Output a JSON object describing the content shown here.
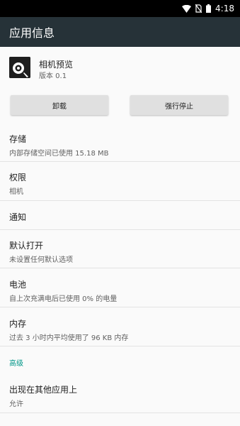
{
  "status_bar": {
    "time": "4:18"
  },
  "app_bar": {
    "title": "应用信息"
  },
  "app": {
    "name": "相机预览",
    "version": "版本 0.1"
  },
  "buttons": {
    "uninstall": "卸载",
    "force_stop": "强行停止"
  },
  "settings": {
    "storage": {
      "title": "存储",
      "summary": "内部存储空间已使用 15.18 MB"
    },
    "permissions": {
      "title": "权限",
      "summary": "相机"
    },
    "notifications": {
      "title": "通知"
    },
    "open_by_default": {
      "title": "默认打开",
      "summary": "未设置任何默认选项"
    },
    "battery": {
      "title": "电池",
      "summary": "自上次充满电后已使用 0% 的电量"
    },
    "memory": {
      "title": "内存",
      "summary": "过去 3 小时内平均使用了 96 KB 内存"
    }
  },
  "advanced": {
    "header": "高级",
    "overlay": {
      "title": "出现在其他应用上",
      "summary": "允许"
    }
  },
  "colors": {
    "status_bar": "#000000",
    "app_bar": "#263238",
    "accent": "#009688",
    "background": "#fafafa"
  }
}
